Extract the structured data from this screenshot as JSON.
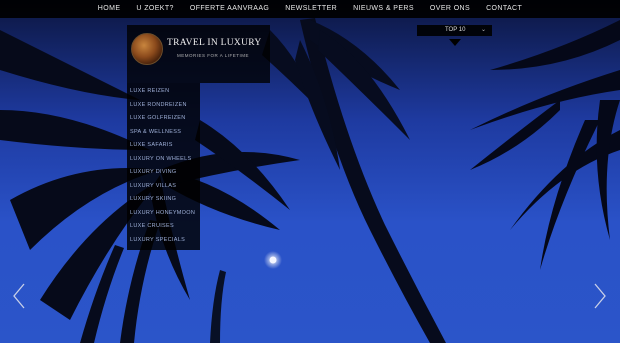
{
  "nav": {
    "items": [
      {
        "label": "HOME"
      },
      {
        "label": "U ZOEKT?"
      },
      {
        "label": "OFFERTE AANVRAAG"
      },
      {
        "label": "NEWSLETTER"
      },
      {
        "label": "NIEUWS & PERS"
      },
      {
        "label": "OVER ONS"
      },
      {
        "label": "CONTACT"
      }
    ]
  },
  "logo": {
    "title": "TRAVEL IN LUXURY",
    "subtitle": "MEMORIES FOR A LIFETIME"
  },
  "menu": {
    "items": [
      {
        "label": "LUXE REIZEN"
      },
      {
        "label": "LUXE RONDREIZEN"
      },
      {
        "label": "LUXE GOLFREIZEN"
      },
      {
        "label": "SPA & WELLNESS"
      },
      {
        "label": "LUXE SAFARIS"
      },
      {
        "label": "LUXURY ON WHEELS"
      },
      {
        "label": "LUXURY DIVING"
      },
      {
        "label": "LUXURY VILLAS"
      },
      {
        "label": "LUXURY SKIING"
      },
      {
        "label": "LUXURY HONEYMOON"
      },
      {
        "label": "LUXE CRUISES"
      },
      {
        "label": "LUXURY SPECIALS"
      }
    ]
  },
  "top10": {
    "label": "TOP 10"
  },
  "colors": {
    "nav_bg": "#000000",
    "menu_text": "#9fb0d8",
    "sky": "#2a52c8"
  },
  "icons": {
    "prev": "chevron-left-icon",
    "next": "chevron-right-icon",
    "dropdown": "chevron-down-icon"
  }
}
